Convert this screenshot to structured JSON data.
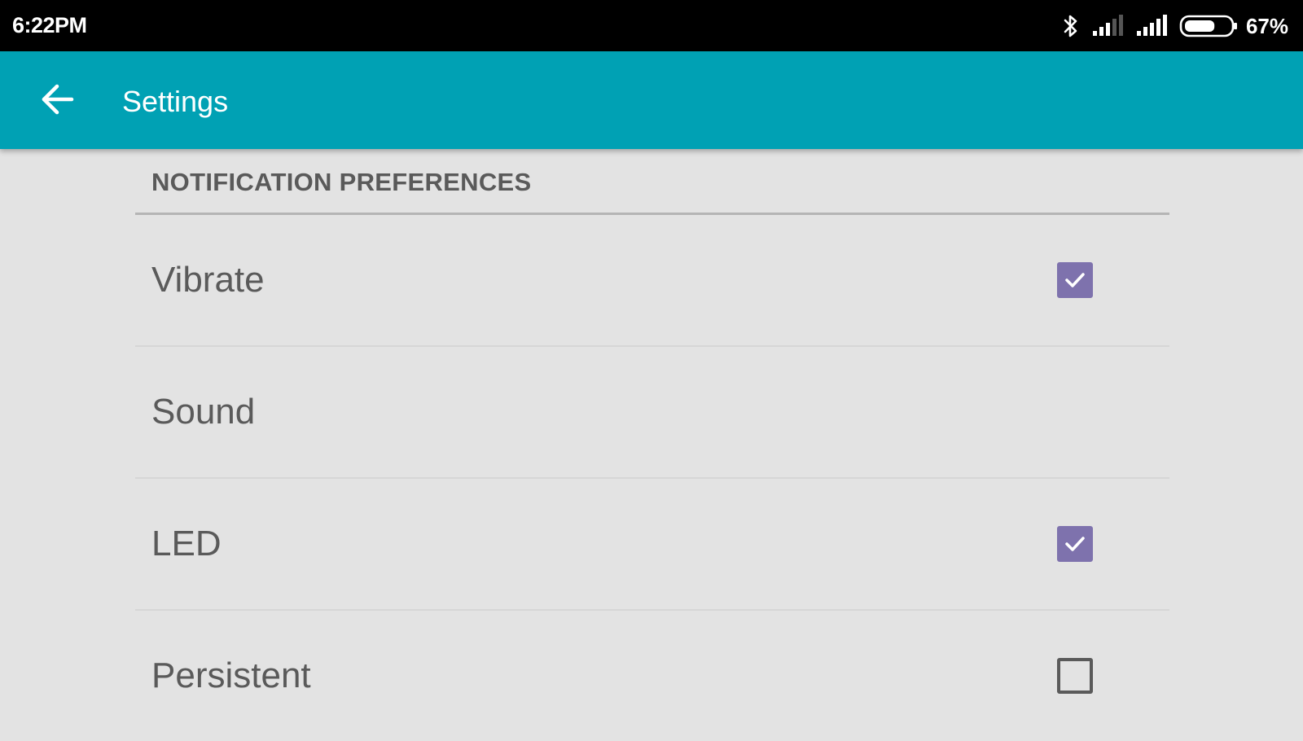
{
  "status_bar": {
    "time": "6:22PM",
    "battery_percent": "67%",
    "battery_level": 0.67,
    "icons": [
      "bluetooth-icon",
      "signal-icon",
      "signal-icon",
      "battery-icon"
    ]
  },
  "app_bar": {
    "title": "Settings",
    "back_icon": "back-arrow-icon",
    "color": "#00a1b4"
  },
  "section": {
    "title": "NOTIFICATION PREFERENCES"
  },
  "preferences": [
    {
      "label": "Vibrate",
      "checkbox": "checked"
    },
    {
      "label": "Sound",
      "checkbox": "none"
    },
    {
      "label": "LED",
      "checkbox": "checked"
    },
    {
      "label": "Persistent",
      "checkbox": "unchecked"
    }
  ],
  "colors": {
    "background": "#e3e3e3",
    "checkbox_accent": "#7e72ad",
    "text": "#5a5a5a"
  }
}
